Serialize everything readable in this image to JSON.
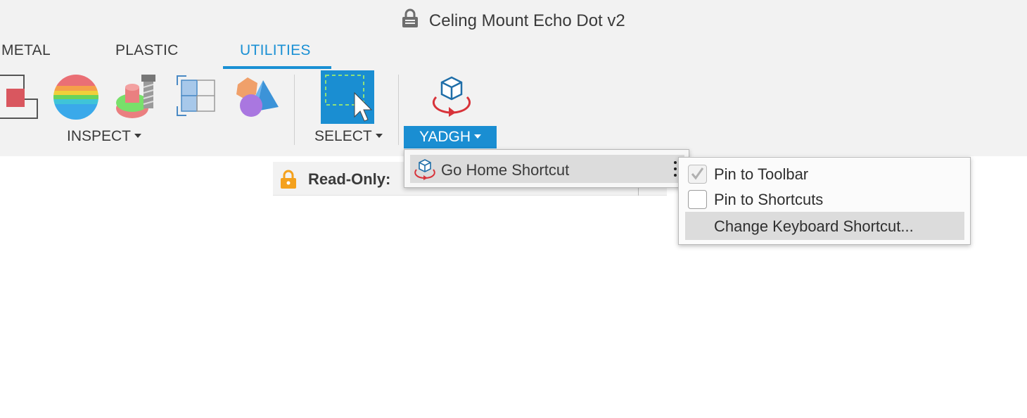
{
  "window": {
    "title": "Celing Mount Echo Dot v2"
  },
  "tabs": [
    {
      "label": "METAL",
      "active": false
    },
    {
      "label": "PLASTIC",
      "active": false
    },
    {
      "label": "UTILITIES",
      "active": true
    }
  ],
  "toolbar": {
    "inspect_label": "INSPECT",
    "select_label": "SELECT",
    "custom_label": "YADGH"
  },
  "readonly": {
    "label": "Read-Only:"
  },
  "context_menu": {
    "item_label": "Go Home Shortcut"
  },
  "submenu": {
    "items": [
      {
        "label": "Pin to Toolbar",
        "checked": true
      },
      {
        "label": "Pin to Shortcuts",
        "checked": false
      },
      {
        "label": "Change Keyboard Shortcut...",
        "highlighted": true
      }
    ]
  },
  "colors": {
    "accent": "#1a8ed2",
    "tab_active": "#1a90d4",
    "toolbar_bg": "#f2f2f2",
    "lock_orange": "#f4a11d"
  }
}
